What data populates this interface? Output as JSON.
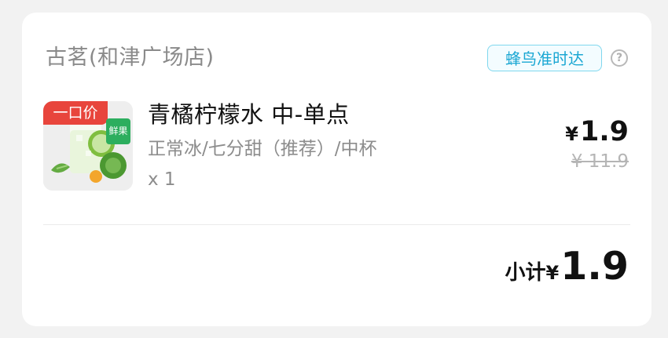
{
  "store": {
    "name": "古茗(和津广场店)",
    "delivery_badge": "蜂鸟准时达",
    "help_icon": "?"
  },
  "item": {
    "name": "青橘柠檬水 中-单点",
    "spec": "正常冰/七分甜（推荐）/中杯",
    "quantity": "x 1",
    "price_tag": "一口价",
    "fresh_tag": "鲜果",
    "currency": "¥",
    "price": "1.9",
    "original_price": "¥ 11.9"
  },
  "summary": {
    "label": "小计",
    "currency": "¥",
    "amount": "1.9"
  },
  "colors": {
    "accent_blue": "#1ba7d3",
    "price_tag_red": "#e8453c",
    "fresh_green": "#2cae5e"
  }
}
